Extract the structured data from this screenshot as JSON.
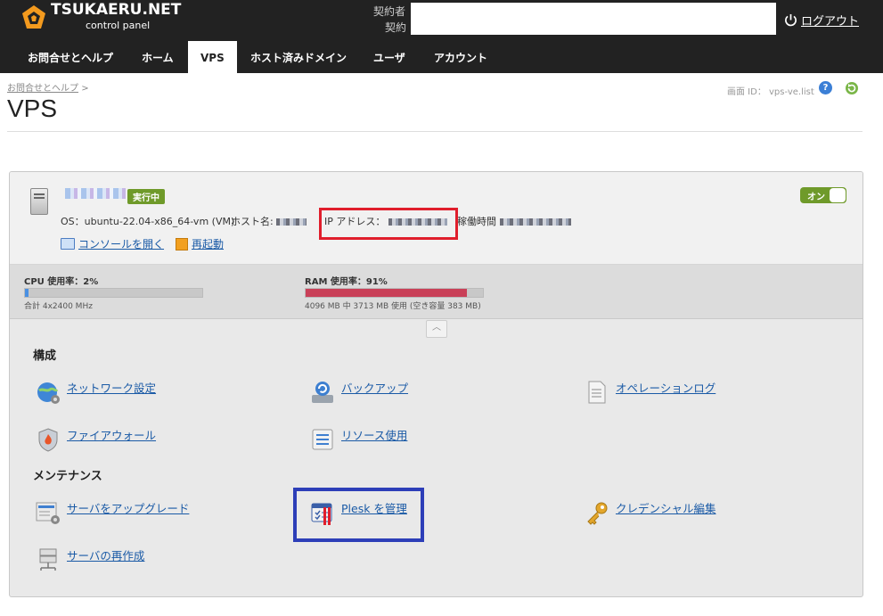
{
  "header": {
    "brand_title": "TSUKAERU.NET",
    "brand_sub": "control panel",
    "account_label_1": "契約者",
    "account_label_2": "契約",
    "logout_label": "ログアウト"
  },
  "nav": {
    "tabs": [
      {
        "label": "お問合せとヘルプ"
      },
      {
        "label": "ホーム"
      },
      {
        "label": "VPS"
      },
      {
        "label": "ホスト済みドメイン"
      },
      {
        "label": "ユーザ"
      },
      {
        "label": "アカウント"
      }
    ],
    "active_index": 2
  },
  "page": {
    "breadcrumb": "お問合せとヘルプ",
    "breadcrumb_sep": ">",
    "title": "VPS",
    "screen_id_label": "画面 ID：",
    "screen_id_value": "vps-ve.list"
  },
  "vps": {
    "status_badge": "実行中",
    "os": "OS：ubuntu-22.04-x86_64-vm (VM)",
    "hostname_label": "ホスト名:",
    "ip_label": "IP アドレス：",
    "uptime_label": "稼働時間",
    "console_link": "コンソールを開く",
    "restart_link": "再起動",
    "power_label": "オン"
  },
  "usage": {
    "cpu_label": "CPU 使用率：2%",
    "cpu_fraction": 0.02,
    "cpu_sub": "合計 4x2400 MHz",
    "ram_label": "RAM 使用率：91%",
    "ram_fraction": 0.91,
    "ram_sub": "4096 MB 中 3713 MB 使用 (空き容量 383 MB)"
  },
  "sections": {
    "config_title": "構成",
    "maint_title": "メンテナンス",
    "network": "ネットワーク設定",
    "backup": "バックアップ",
    "oplog": "オペレーションログ",
    "firewall": "ファイアウォール",
    "resource": "リソース使用",
    "upgrade": "サーバをアップグレード",
    "plesk": "Plesk を管理",
    "credential": "クレデンシャル編集",
    "recreate": "サーバの再作成"
  }
}
